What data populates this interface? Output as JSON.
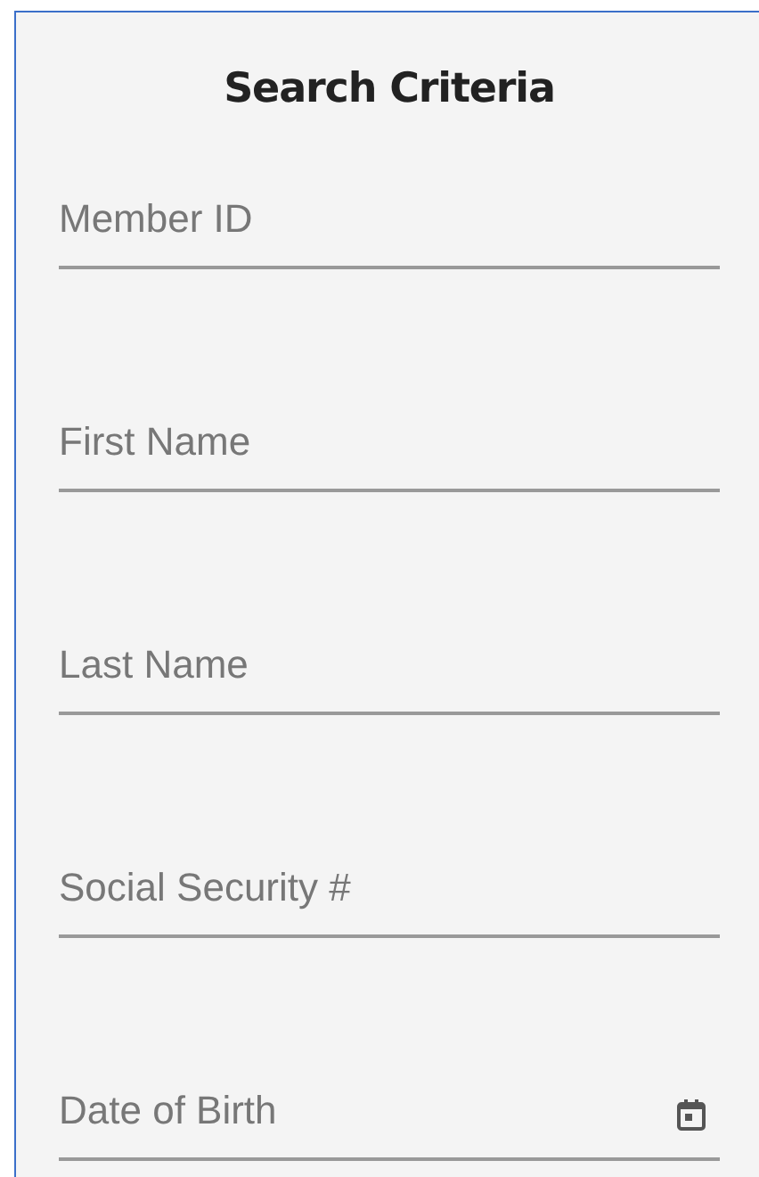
{
  "title": "Search Criteria",
  "fields": [
    {
      "placeholder": "Member ID",
      "kind": "text"
    },
    {
      "placeholder": "First Name",
      "kind": "text"
    },
    {
      "placeholder": "Last Name",
      "kind": "text"
    },
    {
      "placeholder": "Social Security #",
      "kind": "text"
    },
    {
      "placeholder": "Date of Birth",
      "kind": "date"
    }
  ]
}
